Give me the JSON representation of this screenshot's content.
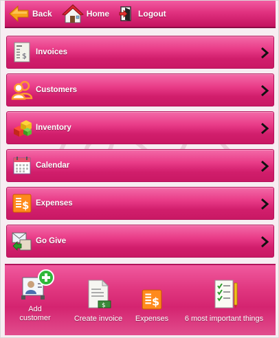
{
  "topbar": {
    "back_label": "Back",
    "home_label": "Home",
    "logout_label": "Logout"
  },
  "menu": {
    "items": [
      {
        "label": "Invoices",
        "icon": "invoice-icon"
      },
      {
        "label": "Customers",
        "icon": "customers-icon"
      },
      {
        "label": "Inventory",
        "icon": "inventory-icon"
      },
      {
        "label": "Calendar",
        "icon": "calendar-icon"
      },
      {
        "label": "Expenses",
        "icon": "expenses-icon"
      },
      {
        "label": "Go Give",
        "icon": "go-give-icon"
      }
    ]
  },
  "toolbar": {
    "add_customer_line1": "Add",
    "add_customer_line2": "customer",
    "create_invoice_label": "Create invoice",
    "expenses_label": "Expenses",
    "important_things_label": "6 most important things"
  },
  "colors": {
    "accent": "#e0317f",
    "accent_dark": "#c41360",
    "background": "#f7edf2"
  }
}
